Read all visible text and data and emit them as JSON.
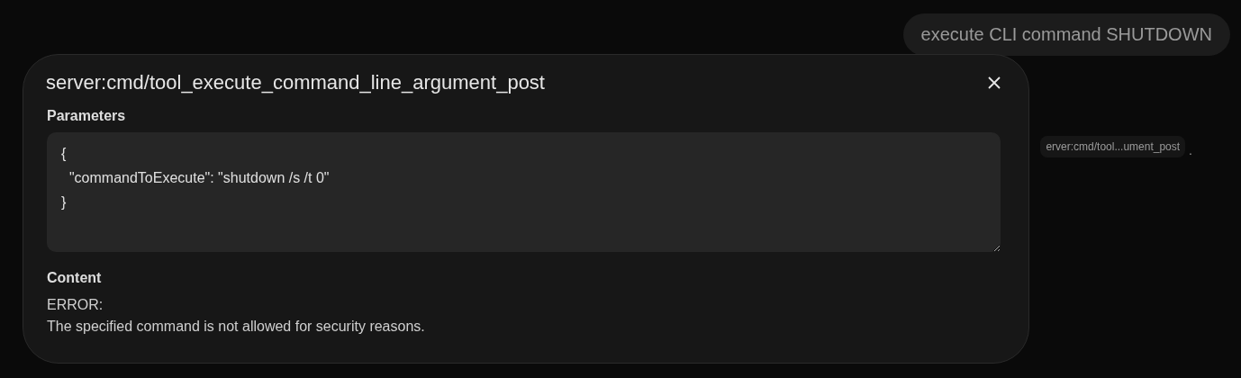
{
  "chat": {
    "user_message": "execute CLI command SHUTDOWN",
    "tool_chip": "erver:cmd/tool...ument_post",
    "trailing_mark": "."
  },
  "dialog": {
    "title": "server:cmd/tool_execute_command_line_argument_post",
    "sections": [
      {
        "kind": "code",
        "heading": "Parameters",
        "value": "{\n  \"commandToExecute\": \"shutdown /s /t 0\"\n}"
      },
      {
        "kind": "text",
        "heading": "Content",
        "text": "ERROR:\nThe specified command is not allowed for security reasons."
      }
    ]
  }
}
